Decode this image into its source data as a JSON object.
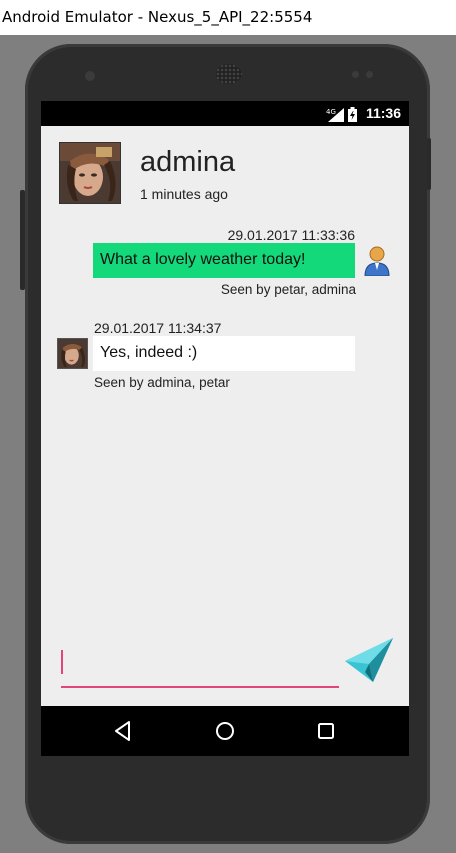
{
  "window": {
    "title": "Android Emulator - Nexus_5_API_22:5554"
  },
  "status_bar": {
    "network": "4G",
    "time": "11:36"
  },
  "chat_header": {
    "name": "admina",
    "last_seen": "1 minutes ago"
  },
  "messages": [
    {
      "direction": "outgoing",
      "timestamp": "29.01.2017 11:33:36",
      "text": "What a lovely weather today!",
      "seen": "Seen by petar, admina",
      "color": "#13d97a"
    },
    {
      "direction": "incoming",
      "timestamp": "29.01.2017 11:34:37",
      "text": "Yes, indeed :)",
      "seen": "Seen by admina, petar",
      "color": "#ffffff"
    }
  ],
  "composer": {
    "value": "",
    "placeholder": "",
    "accent": "#e0457b",
    "send_icon": "paper-plane-icon"
  },
  "nav": {
    "back_icon": "back-icon",
    "home_icon": "home-icon",
    "recents_icon": "recents-icon"
  }
}
